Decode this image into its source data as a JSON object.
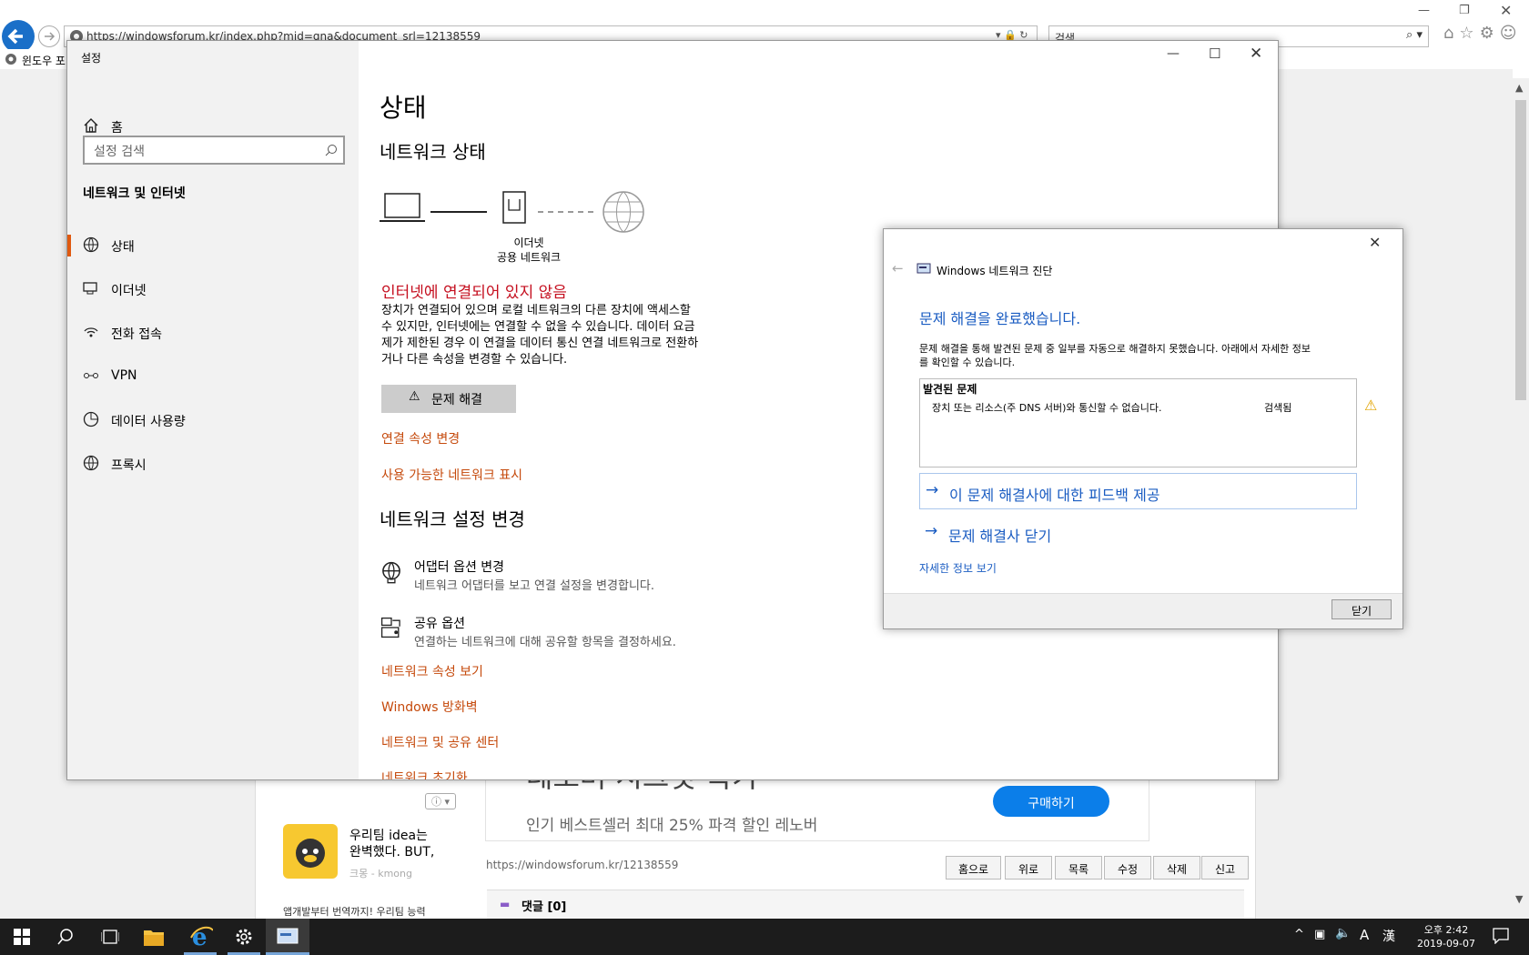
{
  "browser": {
    "address": "https://windowsforum.kr/index.php?mid=qna&document_srl=12138559",
    "search_placeholder": "검색...",
    "tab_label": "윈도우 포",
    "page": {
      "banner_title": "레노버 시크릿 특가",
      "banner_sub": "인기 베스트셀러 최대 25% 파격 할인 레노버",
      "buy_label": "구매하기",
      "ad_text1": "우리팀 idea는",
      "ad_text2": "완벽했다. BUT,",
      "ad_source": "크몽 - kmong",
      "ad_text3": "앱개발부터 번역까지! 우리팀 능력",
      "short_url": "https://windowsforum.kr/12138559",
      "buttons": [
        "홈으로",
        "위로",
        "목록",
        "수정",
        "삭제",
        "신고"
      ],
      "comments": "댓글 [0]"
    }
  },
  "settings": {
    "window_title": "설정",
    "home": "홈",
    "search_placeholder": "설정 검색",
    "section": "네트워크 및 인터넷",
    "nav": [
      {
        "label": "상태",
        "icon": "status-icon"
      },
      {
        "label": "이더넷",
        "icon": "ethernet-icon"
      },
      {
        "label": "전화 접속",
        "icon": "dialup-icon"
      },
      {
        "label": "VPN",
        "icon": "vpn-icon"
      },
      {
        "label": "데이터 사용량",
        "icon": "data-usage-icon"
      },
      {
        "label": "프록시",
        "icon": "proxy-icon"
      }
    ],
    "main": {
      "title": "상태",
      "network_status": "네트워크 상태",
      "net_label1": "이더넷",
      "net_label2": "공용 네트워크",
      "error_title": "인터넷에 연결되어 있지 않음",
      "error_desc_lines": [
        "장치가 연결되어 있으며 로컬 네트워크의 다른 장치에 액세스할",
        "수 있지만, 인터넷에는 연결할 수 없을 수 있습니다. 데이터 요금",
        "제가 제한된 경우 이 연결을 데이터 통신 연결 네트워크로 전환하",
        "거나 다른 속성을 변경할 수 있습니다."
      ],
      "troubleshoot": "문제 해결",
      "link_conn_props": "연결 속성 변경",
      "link_show_nets": "사용 가능한 네트워크 표시",
      "change_title": "네트워크 설정 변경",
      "adapter_title": "어댑터 옵션 변경",
      "adapter_desc": "네트워크 어댑터를 보고 연결 설정을 변경합니다.",
      "sharing_title": "공유 옵션",
      "sharing_desc": "연결하는 네트워크에 대해 공유할 항목을 결정하세요.",
      "link_net_props": "네트워크 속성 보기",
      "link_firewall": "Windows 방화벽",
      "link_sharing_center": "네트워크 및 공유 센터",
      "link_reset": "네트워크 초기화"
    }
  },
  "dialog": {
    "title": "Windows 네트워크 진단",
    "heading": "문제 해결을 완료했습니다.",
    "desc_lines": [
      "문제 해결을 통해 발견된 문제 중 일부를 자동으로 해결하지 못했습니다. 아래에서 자세한 정보",
      "를 확인할 수 있습니다."
    ],
    "found_header": "발견된 문제",
    "problem": "장치 또는 리소스(주 DNS 서버)와 통신할 수 없습니다.",
    "problem_status": "검색됨",
    "feedback": "이 문제 해결사에 대한 피드백 제공",
    "close_troubleshooter": "문제 해결사 닫기",
    "details": "자세한 정보 보기",
    "close_button": "닫기"
  },
  "taskbar": {
    "time": "오후 2:42",
    "date": "2019-09-07",
    "ime": "A",
    "ime2": "漢"
  }
}
